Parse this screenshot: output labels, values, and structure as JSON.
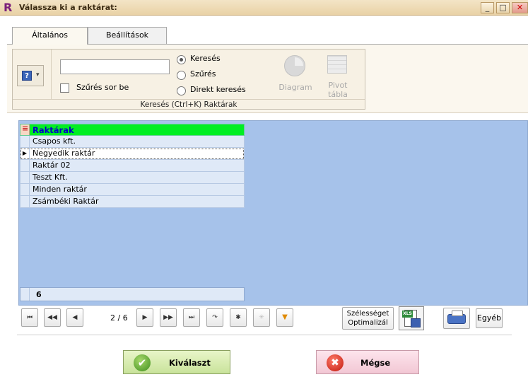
{
  "window": {
    "logo": "R",
    "title": "Válassza ki a raktárat:",
    "min_glyph": "_",
    "max_glyph": "□",
    "close_glyph": "✕"
  },
  "tabs": [
    {
      "label": "Általános"
    },
    {
      "label": "Beállítások"
    }
  ],
  "ribbon": {
    "help_glyph": "?",
    "dropdown_glyph": "▾",
    "search_value": "",
    "filter_checkbox_label": "Szűrés sor be",
    "radio_options": [
      {
        "label": "Keresés",
        "checked": true
      },
      {
        "label": "Szűrés",
        "checked": false
      },
      {
        "label": "Direkt keresés",
        "checked": false
      }
    ],
    "diagram_label": "Diagram",
    "pivot_label_line1": "Pivot",
    "pivot_label_line2": "tábla",
    "group_caption": "Keresés (Ctrl+K) Raktárak"
  },
  "grid": {
    "column_header": "Raktárak",
    "rows": [
      {
        "name": "Csapos kft."
      },
      {
        "name": "Negyedik raktár",
        "selected": true
      },
      {
        "name": "Raktár 02"
      },
      {
        "name": "Teszt Kft."
      },
      {
        "name": "Minden raktár"
      },
      {
        "name": "Zsámbéki Raktár"
      }
    ],
    "row_marker": "▶",
    "footer_count": "6"
  },
  "navigator": {
    "first": "⏮",
    "prev_page": "◀◀",
    "prev": "◀",
    "position": "2 / 6",
    "next": "▶",
    "next_page": "▶▶",
    "last": "⏭",
    "refresh": "↷",
    "new_record": "✱",
    "disabled_action": "✳",
    "filter": "▼",
    "optimize_line1": "Szélességet",
    "optimize_line2": "Optimalizál",
    "xls_tag": "XLS",
    "other": "Egyéb"
  },
  "actions": {
    "ok_icon": "✔",
    "ok_label": "Kiválaszt",
    "cancel_icon": "✖",
    "cancel_label": "Mégse"
  },
  "colors": {
    "header_green": "#00ee22",
    "grid_background": "#a6c2ea",
    "title_accent": "#7a1f7a"
  }
}
